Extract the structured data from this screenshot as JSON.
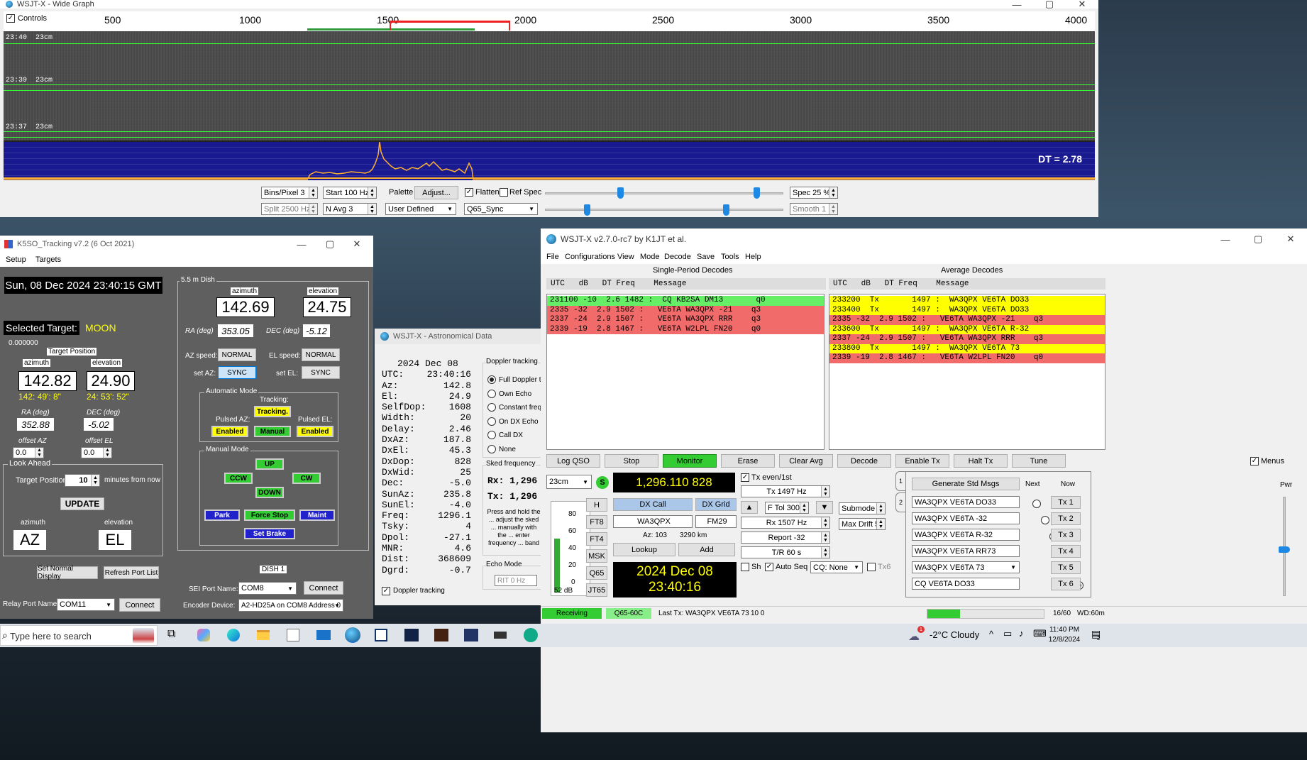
{
  "colors": {
    "green": "#66ee66",
    "red": "#f26b6b",
    "yellow": "#ffff00",
    "waterfall_blue": "#1a1a90",
    "accent_green": "#33dd33"
  },
  "wide_graph": {
    "title": "WSJT-X - Wide Graph",
    "controls_label": "Controls",
    "ruler_ticks": [
      "500",
      "1000",
      "1500",
      "2000",
      "2500",
      "3000",
      "3500",
      "4000"
    ],
    "time_labels": [
      {
        "t": "23:40",
        "band": "23cm"
      },
      {
        "t": "23:39",
        "band": "23cm"
      },
      {
        "t": "23:37",
        "band": "23cm"
      }
    ],
    "dt_text": "DT =  2.78",
    "bins_pixel": "Bins/Pixel  3",
    "start": "Start 100 Hz",
    "palette_label": "Palette",
    "adjust": "Adjust...",
    "flatten": "Flatten",
    "ref_spec": "Ref Spec",
    "spec": "Spec 25 %",
    "split": "Split  2500  Hz",
    "navg": "N Avg 3",
    "palette_value": "User Defined",
    "mode_value": "Q65_Sync",
    "smooth": "Smooth  1"
  },
  "k5so": {
    "title": "K5SO_Tracking v7.2  (6 Oct 2021)",
    "menu": [
      "Setup",
      "Targets"
    ],
    "datetime": "Sun, 08 Dec 2024 23:40:15 GMT",
    "selected_target_label": "Selected Target:",
    "selected_target": "MOON",
    "small_value": "0.000000",
    "target_position": "Target Position",
    "azimuth_label": "azimuth",
    "elevation_label": "elevation",
    "az": "142.82",
    "el": "24.90",
    "az_dms": "142: 49': 8\"",
    "el_dms": "24: 53': 52\"",
    "ra_label": "RA (deg)",
    "dec_label": "DEC (deg)",
    "ra": "352.88",
    "dec": "-5.02",
    "offset_az_label": "offset AZ",
    "offset_el_label": "offset EL",
    "offset_az": "0.0",
    "offset_el": "0.0",
    "look_ahead": "Look Ahead",
    "target_position2": "Target Position",
    "minutes": "10",
    "minutes_from_now": "minutes from now",
    "update": "UPDATE",
    "azimuth2": "azimuth",
    "elevation2": "elevation",
    "az_big": "AZ",
    "el_big": "EL",
    "set_normal": "Set Normal Display",
    "refresh_port": "Refresh Port List",
    "relay_port_label": "Relay Port Name:",
    "relay_port": "COM11",
    "connect": "Connect",
    "dish_label": "5.5 m Dish",
    "dish_az_label": "azimuth",
    "dish_el_label": "elevation",
    "dish_az": "142.69",
    "dish_el": "24.75",
    "dish_ra_label": "RA (deg)",
    "dish_dec_label": "DEC (deg)",
    "dish_ra": "353.05",
    "dish_dec": "-5.12",
    "az_speed_label": "AZ speed:",
    "el_speed_label": "EL speed:",
    "az_speed": "NORMAL",
    "el_speed": "NORMAL",
    "set_az_label": "set AZ:",
    "set_el_label": "set EL:",
    "sync": "SYNC",
    "auto_mode": "Automatic Mode",
    "tracking_label": "Tracking:",
    "tracking_btn": "Tracking.",
    "pulsed_az": "Pulsed AZ:",
    "pulsed_el": "Pulsed EL:",
    "enabled": "Enabled",
    "manual": "Manual",
    "manual_mode": "Manual Mode",
    "up": "UP",
    "ccw": "CCW",
    "cw": "CW",
    "down": "DOWN",
    "park": "Park",
    "force_stop": "Force Stop",
    "maint": "Maint",
    "set_brake": "Set Brake",
    "dish1": "DISH 1",
    "sei_port_label": "SEI Port Name:",
    "sei_port": "COM8",
    "encoder_label": "Encoder Device:",
    "encoder": "A2-HD25A on COM8 Address 0"
  },
  "astro": {
    "title": "WSJT-X - Astronomical Data",
    "date": "2024 Dec 08",
    "rows": [
      {
        "k": "UTC:",
        "v": "23:40:16"
      },
      {
        "k": "Az:",
        "v": "142.8"
      },
      {
        "k": "El:",
        "v": "24.9"
      },
      {
        "k": "SelfDop:",
        "v": "1608"
      },
      {
        "k": "Width:",
        "v": "20"
      },
      {
        "k": "Delay:",
        "v": "2.46"
      },
      {
        "k": "DxAz:",
        "v": "187.8"
      },
      {
        "k": "DxEl:",
        "v": "45.3"
      },
      {
        "k": "DxDop:",
        "v": "828"
      },
      {
        "k": "DxWid:",
        "v": "25"
      },
      {
        "k": "Dec:",
        "v": "-5.0"
      },
      {
        "k": "SunAz:",
        "v": "235.8"
      },
      {
        "k": "SunEl:",
        "v": "-4.0"
      },
      {
        "k": "Freq:",
        "v": "1296.1"
      },
      {
        "k": "Tsky:",
        "v": "4"
      },
      {
        "k": "Dpol:",
        "v": "-27.1"
      },
      {
        "k": "MNR:",
        "v": "4.6"
      },
      {
        "k": "Dist:",
        "v": "368609"
      },
      {
        "k": "Dgrd:",
        "v": "-0.7"
      }
    ],
    "doppler_tracking": "Doppler tracking",
    "doppler_opts": [
      "Full Doppler to",
      "Own Echo",
      "Constant freq",
      "On DX Echo",
      "Call DX",
      "None"
    ],
    "sked": "Sked frequency",
    "rx": "Rx:  1,296",
    "tx": "Tx:  1,296",
    "press_hold": "Press and hold the ... adjust the sked ... manually with the ... enter frequency ... band entry field ... window.",
    "echo_mode": "Echo Mode",
    "rit": "RIT  0  Hz",
    "doppler_check": "Doppler tracking"
  },
  "wsjtx": {
    "title": "WSJT-X   v2.7.0-rc7   by K1JT et al.",
    "menu": [
      "File",
      "Configurations",
      "View",
      "Mode",
      "Decode",
      "Save",
      "Tools",
      "Help"
    ],
    "single_title": "Single-Period Decodes",
    "average_title": "Average Decodes",
    "header": "UTC   dB   DT Freq    Message",
    "single_rows": [
      {
        "text": "231100 -10  2.6 1482 :  CQ KB2SA DM13       q0",
        "c": "green"
      },
      {
        "text": "2335 -32  2.9 1502 :   VE6TA WA3QPX -21    q3",
        "c": "red"
      },
      {
        "text": "2337 -24  2.9 1507 :   VE6TA WA3QPX RRR    q3",
        "c": "red"
      },
      {
        "text": "2339 -19  2.8 1467 :   VE6TA W2LPL FN20    q0",
        "c": "red"
      }
    ],
    "average_rows": [
      {
        "text": "233200  Tx       1497 :  WA3QPX VE6TA DO33",
        "c": "yellow"
      },
      {
        "text": "233400  Tx       1497 :  WA3QPX VE6TA DO33",
        "c": "yellow"
      },
      {
        "text": "2335 -32  2.9 1502 :   VE6TA WA3QPX -21    q3",
        "c": "red"
      },
      {
        "text": "233600  Tx       1497 :  WA3QPX VE6TA R-32",
        "c": "yellow"
      },
      {
        "text": "2337 -24  2.9 1507 :   VE6TA WA3QPX RRR    q3",
        "c": "red"
      },
      {
        "text": "233800  Tx       1497 :  WA3QPX VE6TA 73",
        "c": "yellow"
      },
      {
        "text": "2339 -19  2.8 1467 :   VE6TA W2LPL FN20    q0",
        "c": "red"
      }
    ],
    "buttons": [
      "Log QSO",
      "Stop",
      "Monitor",
      "Erase",
      "Clear Avg",
      "Decode",
      "Enable Tx",
      "Halt Tx",
      "Tune"
    ],
    "menus_label": "Menus",
    "band": "23cm",
    "s_badge": "S",
    "freq": "1,296.110 828",
    "scale": [
      "80",
      "60",
      "40",
      "20",
      "0"
    ],
    "db": "52 dB",
    "side_btns": [
      "H",
      "FT8",
      "FT4",
      "MSK",
      "Q65",
      "JT65"
    ],
    "dx_call_label": "DX Call",
    "dx_grid_label": "DX Grid",
    "dx_call": "WA3QPX",
    "dx_grid": "FM29",
    "az": "Az: 103",
    "dist": "3290 km",
    "lookup": "Lookup",
    "add": "Add",
    "clock_date": "2024 Dec 08",
    "clock_time": "23:40:16",
    "tx_even": "Tx even/1st",
    "tx_freq": "Tx  1497  Hz",
    "ftol": "F Tol  300",
    "rx_freq": "Rx  1507  Hz",
    "report": "Report -32",
    "tr": "T/R  60  s",
    "sh": "Sh",
    "auto_seq": "Auto Seq",
    "cq": "CQ: None",
    "tx6": "Tx6",
    "submode": "Submode C",
    "max_drift": "Max Drift  50",
    "gen_std": "Generate Std Msgs",
    "next": "Next",
    "now": "Now",
    "pwr": "Pwr",
    "tab1": "1",
    "tab2": "2",
    "tx_msgs": [
      {
        "msg": "WA3QPX VE6TA DO33",
        "btn": "Tx 1"
      },
      {
        "msg": "WA3QPX VE6TA -32",
        "btn": "Tx 2"
      },
      {
        "msg": "WA3QPX VE6TA R-32",
        "btn": "Tx 3"
      },
      {
        "msg": "WA3QPX VE6TA RR73",
        "btn": "Tx 4"
      },
      {
        "msg": "WA3QPX VE6TA 73",
        "btn": "Tx 5"
      },
      {
        "msg": "CQ VE6TA DO33",
        "btn": "Tx 6"
      }
    ],
    "status_receiving": "Receiving",
    "status_mode": "Q65-60C",
    "status_last_tx": "Last Tx: WA3QPX VE6TA 73",
    "status_10": "10  0",
    "status_count": "16/60",
    "status_wd": "WD:60m"
  },
  "taskbar": {
    "search": "Type here to search",
    "weather": "-2°C  Cloudy",
    "time": "11:40 PM",
    "date": "12/8/2024",
    "notif": "2",
    "weather_badge": "1"
  }
}
